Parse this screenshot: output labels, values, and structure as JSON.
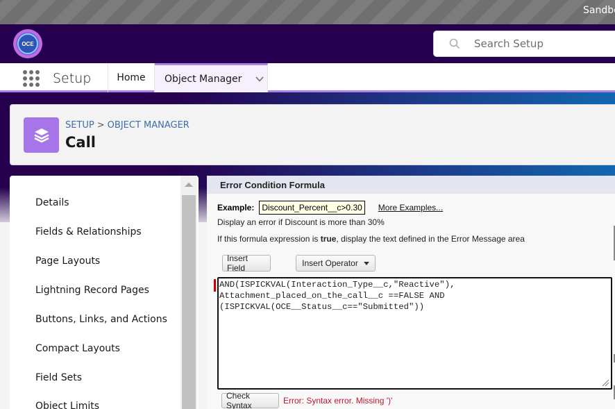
{
  "sandbox": {
    "label": "Sandbox"
  },
  "header": {
    "logo_text": "OCE",
    "search": {
      "placeholder": "Search Setup",
      "icon": "search-icon"
    }
  },
  "nav": {
    "app_launcher_icon": "app-launcher-icon",
    "app_name": "Setup",
    "tabs": [
      {
        "label": "Home",
        "active": false
      },
      {
        "label": "Object Manager",
        "active": true,
        "has_menu": true
      }
    ]
  },
  "object_header": {
    "icon": "layers-icon",
    "breadcrumb": [
      "SETUP",
      "OBJECT MANAGER"
    ],
    "breadcrumb_separator": ">",
    "title": "Call",
    "icon_color": "#a875e8"
  },
  "sidebar": {
    "items": [
      {
        "label": "Details"
      },
      {
        "label": "Fields & Relationships"
      },
      {
        "label": "Page Layouts"
      },
      {
        "label": "Lightning Record Pages"
      },
      {
        "label": "Buttons, Links, and Actions"
      },
      {
        "label": "Compact Layouts"
      },
      {
        "label": "Field Sets"
      },
      {
        "label": "Object Limits"
      }
    ]
  },
  "main": {
    "section_title": "Error Condition Formula",
    "example": {
      "label": "Example:",
      "value": "Discount_Percent__c>0.30",
      "more_link": "More Examples..."
    },
    "hint_discount": "Display an error if Discount is more than 30%",
    "hint_true": {
      "prefix": "If this formula expression is ",
      "bold": "true",
      "suffix": ", display the text defined in the Error Message area"
    },
    "insert_field_label": "Insert Field",
    "insert_operator_label": "Insert Operator",
    "formula": "AND(ISPICKVAL(Interaction_Type__c,\"Reactive\"),\nAttachment_placed_on_the_call__c ==FALSE AND\n(ISPICKVAL(OCE__Status__c==\"Submitted\"))",
    "check_syntax_label": "Check Syntax",
    "error_message": "Error: Syntax error. Missing ')'",
    "error_color": "#c0142b"
  }
}
